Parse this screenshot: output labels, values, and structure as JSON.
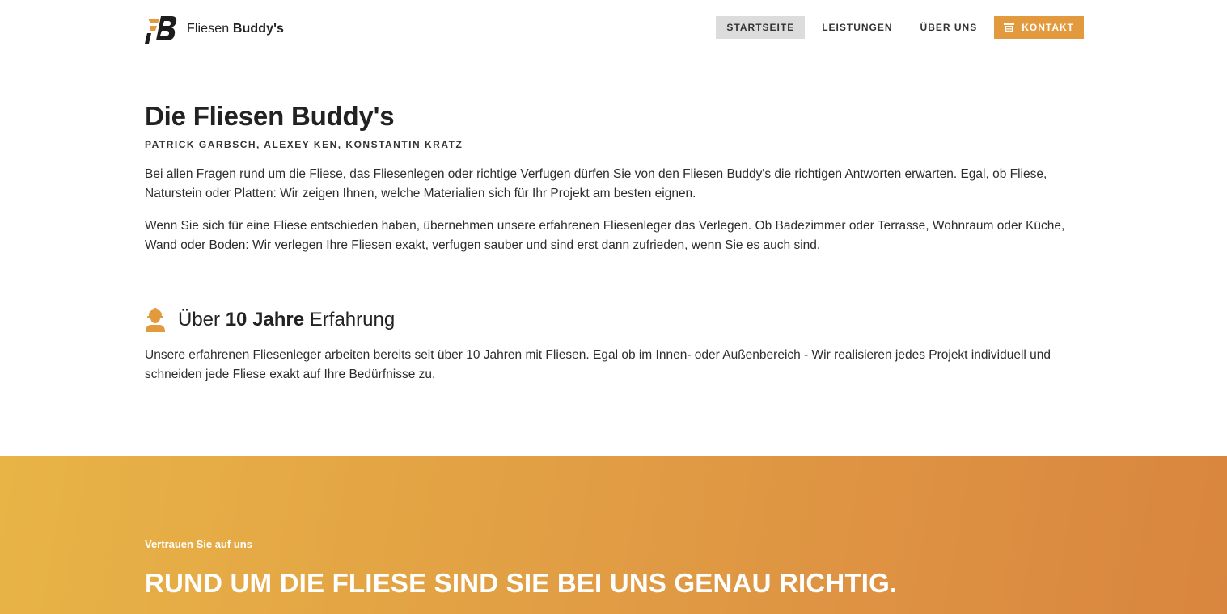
{
  "brand": {
    "logo_icon": "fb-logo-icon",
    "name_regular": "Fliesen",
    "name_bold": "Buddy's"
  },
  "nav": {
    "items": [
      {
        "label": "STARTSEITE",
        "active": true
      },
      {
        "label": "LEISTUNGEN",
        "active": false
      },
      {
        "label": "ÜBER UNS",
        "active": false
      }
    ],
    "cta": {
      "label": "KONTAKT",
      "icon": "cart-icon"
    }
  },
  "intro": {
    "title": "Die Fliesen Buddy's",
    "subtitle": "PATRICK GARBSCH, ALEXEY KEN, KONSTANTIN KRATZ",
    "paragraphs": [
      "Bei allen Fragen rund um die Fliese, das Fliesenlegen oder richtige Verfugen dürfen Sie von den Fliesen Buddy's die richtigen Antworten erwarten. Egal, ob Fliese, Naturstein oder Platten: Wir zeigen Ihnen, welche Materialien sich für Ihr Projekt am besten eignen.",
      "Wenn Sie sich für eine Fliese entschieden haben, übernehmen unsere erfahrenen Fliesenleger das Verlegen. Ob Badezimmer oder Terrasse, Wohnraum oder Küche, Wand oder Boden: Wir verlegen Ihre Fliesen exakt, verfugen sauber und sind erst dann zufrieden, wenn Sie es auch sind."
    ]
  },
  "experience": {
    "icon": "construction-worker-icon",
    "title_prefix": "Über",
    "title_bold": "10 Jahre",
    "title_suffix": "Erfahrung",
    "text": "Unsere erfahrenen Fliesenleger arbeiten bereits seit über 10 Jahren mit Fliesen. Egal ob im Innen- oder Außenbereich - Wir realisieren jedes Projekt individuell und schneiden jede Fliese exakt auf Ihre Bedürfnisse zu."
  },
  "banner": {
    "kicker": "Vertrauen Sie auf uns",
    "title": "RUND UM DIE FLIESE SIND SIE BEI UNS GENAU RICHTIG."
  },
  "colors": {
    "accent": "#e39a3e",
    "banner_start": "#e8b446",
    "banner_end": "#d9853f",
    "active_nav_bg": "#dcdcdc"
  }
}
